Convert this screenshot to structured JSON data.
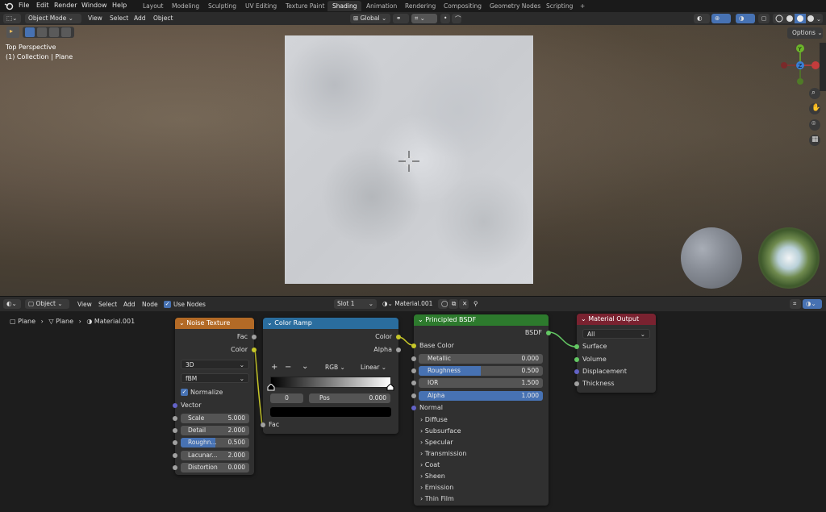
{
  "menu": {
    "file": "File",
    "edit": "Edit",
    "render": "Render",
    "window": "Window",
    "help": "Help"
  },
  "workspaces": [
    "Layout",
    "Modeling",
    "Sculpting",
    "UV Editing",
    "Texture Paint",
    "Shading",
    "Animation",
    "Rendering",
    "Compositing",
    "Geometry Nodes",
    "Scripting",
    "+"
  ],
  "active_workspace": "Shading",
  "viewport": {
    "mode": "Object Mode",
    "view": "View",
    "select": "Select",
    "add": "Add",
    "object": "Object",
    "orientation": "Global",
    "options": "Options",
    "overlay_line1": "Top Perspective",
    "overlay_line2": "(1) Collection | Plane",
    "gizmo_y": "Y",
    "gizmo_z": "Z"
  },
  "node_editor": {
    "type": "Object",
    "view": "View",
    "select": "Select",
    "add": "Add",
    "node": "Node",
    "use_nodes": "Use Nodes",
    "slot": "Slot 1",
    "material": "Material.001",
    "breadcrumb": [
      "Plane",
      "Plane",
      "Material.001"
    ]
  },
  "noise": {
    "title": "Noise Texture",
    "out_fac": "Fac",
    "out_color": "Color",
    "dim": "3D",
    "type": "fBM",
    "normalize": "Normalize",
    "vector": "Vector",
    "scale_l": "Scale",
    "scale_v": "5.000",
    "detail_l": "Detail",
    "detail_v": "2.000",
    "rough_l": "Roughn...",
    "rough_v": "0.500",
    "lac_l": "Lacunar...",
    "lac_v": "2.000",
    "dist_l": "Distortion",
    "dist_v": "0.000"
  },
  "ramp": {
    "title": "Color Ramp",
    "out_color": "Color",
    "out_alpha": "Alpha",
    "plus": "+",
    "minus": "−",
    "chev": "⌄",
    "mode": "RGB",
    "interp": "Linear",
    "index": "0",
    "pos_l": "Pos",
    "pos_v": "0.000",
    "in_fac": "Fac"
  },
  "bsdf": {
    "title": "Principled BSDF",
    "out": "BSDF",
    "base": "Base Color",
    "metal_l": "Metallic",
    "metal_v": "0.000",
    "rough_l": "Roughness",
    "rough_v": "0.500",
    "ior_l": "IOR",
    "ior_v": "1.500",
    "alpha_l": "Alpha",
    "alpha_v": "1.000",
    "normal": "Normal",
    "panels": [
      "Diffuse",
      "Subsurface",
      "Specular",
      "Transmission",
      "Coat",
      "Sheen",
      "Emission",
      "Thin Film"
    ]
  },
  "output": {
    "title": "Material Output",
    "target": "All",
    "surface": "Surface",
    "volume": "Volume",
    "displacement": "Displacement",
    "thickness": "Thickness"
  },
  "colors": {
    "noise_header": "#b36a26",
    "ramp_header": "#2a6d9e",
    "bsdf_header": "#2d7a2d",
    "output_header": "#7a2230",
    "socket_gray": "#a1a1a1",
    "socket_yellow": "#c7c729",
    "socket_green": "#63c763",
    "socket_purple": "#6363c7",
    "accent": "#4772b3"
  },
  "values": {
    "ramp_roughness": 0.5,
    "bsdf_roughness": 0.5,
    "noise_roughness": 0.5
  }
}
